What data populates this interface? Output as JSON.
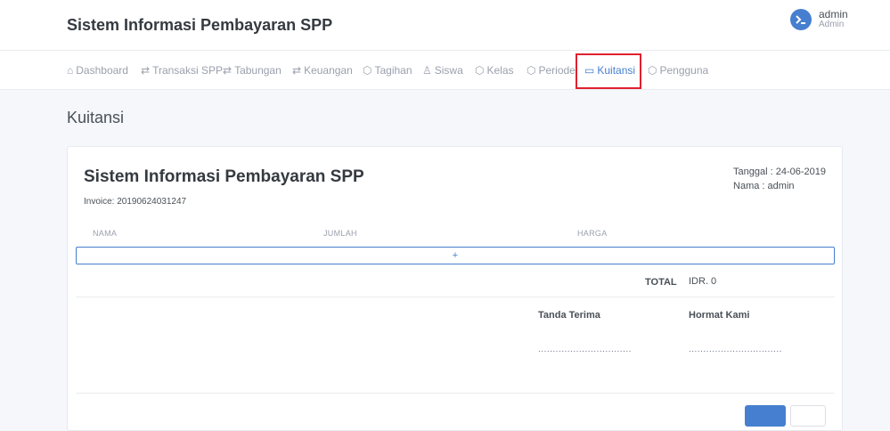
{
  "header": {
    "brand": "Sistem Informasi Pembayaran SPP",
    "user_name": "admin",
    "user_role": "Admin"
  },
  "nav": {
    "items": [
      {
        "label": "Dashboard",
        "icon": "home-icon"
      },
      {
        "label": "Transaksi SPP",
        "icon": "transfer-icon"
      },
      {
        "label": "Tabungan",
        "icon": "transfer-icon"
      },
      {
        "label": "Keuangan",
        "icon": "transfer-icon"
      },
      {
        "label": "Tagihan",
        "icon": "package-icon"
      },
      {
        "label": "Siswa",
        "icon": "users-icon"
      },
      {
        "label": "Kelas",
        "icon": "package-icon"
      },
      {
        "label": "Periode",
        "icon": "package-icon"
      },
      {
        "label": "Kuitansi",
        "icon": "folder-icon"
      },
      {
        "label": "Pengguna",
        "icon": "package-icon"
      }
    ],
    "active": "Kuitansi"
  },
  "page": {
    "title": "Kuitansi"
  },
  "invoice": {
    "title": "Sistem Informasi Pembayaran SPP",
    "number": "Invoice: 20190624031247",
    "tanggal": "Tanggal : 24-06-2019",
    "nama": "Nama : admin",
    "columns": [
      "NAMA",
      "JUMLAH",
      "HARGA"
    ],
    "add_label": "+",
    "total_label": "TOTAL",
    "total_value": "IDR. 0",
    "sign_left": "Tanda Terima",
    "sign_right": "Hormat Kami",
    "sign_dots": "................................"
  },
  "colors": {
    "accent": "#467fcf",
    "highlight": "#e0212f"
  }
}
